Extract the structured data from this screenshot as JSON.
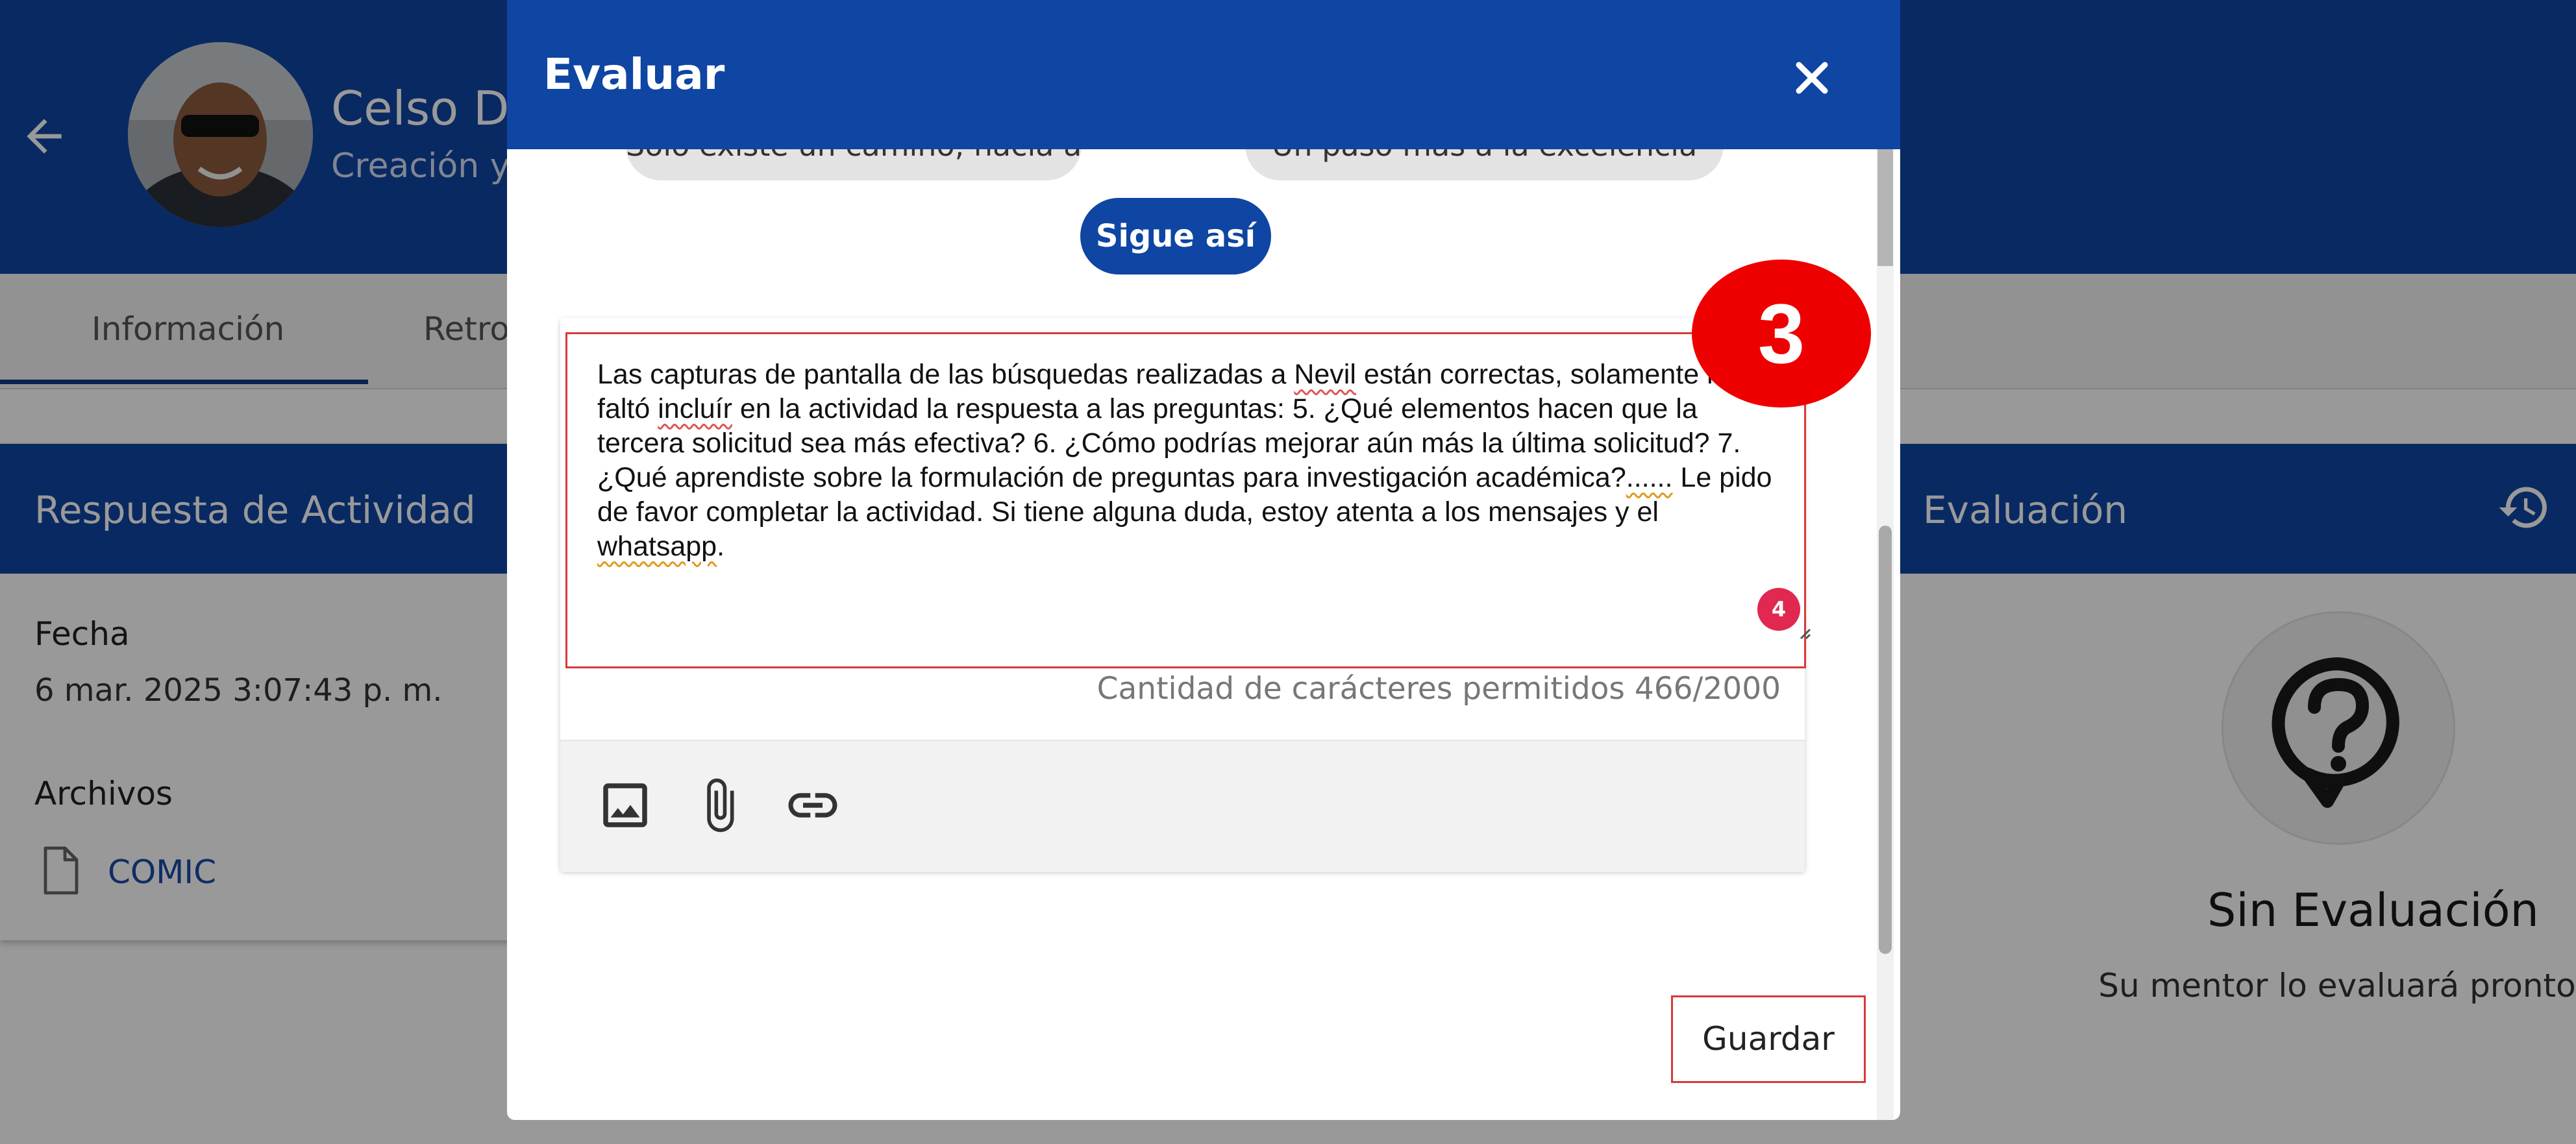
{
  "app": {
    "user_name": "Celso Do",
    "user_subtitle": "Creación y",
    "tabs": [
      "Información",
      "Retro"
    ],
    "response_card": {
      "title": "Respuesta de Actividad",
      "date_label": "Fecha",
      "date_value": "6 mar. 2025 3:07:43 p. m.",
      "files_label": "Archivos",
      "file_name": "COMIC"
    },
    "evaluation_card": {
      "title": "Evaluación",
      "status_title": "Sin Evaluación",
      "status_subtitle": "Su mentor lo evaluará pronto"
    }
  },
  "dialog": {
    "title": "Evaluar",
    "chips": [
      {
        "label": "Solo existe un camino, hacia adelante"
      },
      {
        "label": "Un paso más a la excelencia"
      }
    ],
    "selected_chip": "Sigue así",
    "comment": {
      "s1": "Las capturas de pantalla de las búsquedas realizadas a ",
      "w1": "Nevil",
      "s2": " están correctas, solamente le faltó ",
      "w2": "incluír",
      "s3": " en la actividad la respuesta a las preguntas: 5. ¿Qué elementos hacen que la tercera solicitud sea más efectiva? 6. ¿Cómo podrías mejorar aún más la última solicitud? 7. ¿Qué aprendiste sobre la formulación de preguntas para investigación académica?",
      "w3": "......",
      "s4": " Le pido de favor completar la actividad. Si tiene alguna duda, estoy atenta a los mensajes y el ",
      "w4": "whatsapp",
      "s5": "."
    },
    "spell_badge": "4",
    "char_counter": "Cantidad de carácteres permitidos 466/2000",
    "save_label": "Guardar",
    "step_number": "3"
  },
  "colors": {
    "primary": "#0f45a3",
    "highlight": "#d63a3a",
    "step_badge": "#ee0000",
    "spell_badge": "#e12850"
  },
  "icons": [
    "back-arrow-icon",
    "close-icon",
    "image-icon",
    "attach-icon",
    "link-icon",
    "file-icon",
    "history-icon",
    "question-bubble-icon"
  ]
}
